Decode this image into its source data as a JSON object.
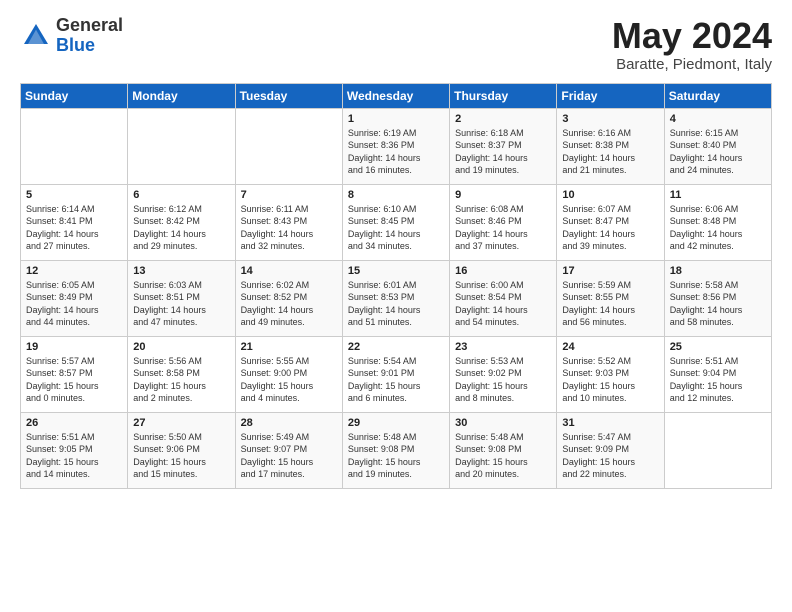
{
  "header": {
    "logo_general": "General",
    "logo_blue": "Blue",
    "month_title": "May 2024",
    "subtitle": "Baratte, Piedmont, Italy"
  },
  "days_of_week": [
    "Sunday",
    "Monday",
    "Tuesday",
    "Wednesday",
    "Thursday",
    "Friday",
    "Saturday"
  ],
  "weeks": [
    [
      {
        "day": "",
        "info": ""
      },
      {
        "day": "",
        "info": ""
      },
      {
        "day": "",
        "info": ""
      },
      {
        "day": "1",
        "info": "Sunrise: 6:19 AM\nSunset: 8:36 PM\nDaylight: 14 hours\nand 16 minutes."
      },
      {
        "day": "2",
        "info": "Sunrise: 6:18 AM\nSunset: 8:37 PM\nDaylight: 14 hours\nand 19 minutes."
      },
      {
        "day": "3",
        "info": "Sunrise: 6:16 AM\nSunset: 8:38 PM\nDaylight: 14 hours\nand 21 minutes."
      },
      {
        "day": "4",
        "info": "Sunrise: 6:15 AM\nSunset: 8:40 PM\nDaylight: 14 hours\nand 24 minutes."
      }
    ],
    [
      {
        "day": "5",
        "info": "Sunrise: 6:14 AM\nSunset: 8:41 PM\nDaylight: 14 hours\nand 27 minutes."
      },
      {
        "day": "6",
        "info": "Sunrise: 6:12 AM\nSunset: 8:42 PM\nDaylight: 14 hours\nand 29 minutes."
      },
      {
        "day": "7",
        "info": "Sunrise: 6:11 AM\nSunset: 8:43 PM\nDaylight: 14 hours\nand 32 minutes."
      },
      {
        "day": "8",
        "info": "Sunrise: 6:10 AM\nSunset: 8:45 PM\nDaylight: 14 hours\nand 34 minutes."
      },
      {
        "day": "9",
        "info": "Sunrise: 6:08 AM\nSunset: 8:46 PM\nDaylight: 14 hours\nand 37 minutes."
      },
      {
        "day": "10",
        "info": "Sunrise: 6:07 AM\nSunset: 8:47 PM\nDaylight: 14 hours\nand 39 minutes."
      },
      {
        "day": "11",
        "info": "Sunrise: 6:06 AM\nSunset: 8:48 PM\nDaylight: 14 hours\nand 42 minutes."
      }
    ],
    [
      {
        "day": "12",
        "info": "Sunrise: 6:05 AM\nSunset: 8:49 PM\nDaylight: 14 hours\nand 44 minutes."
      },
      {
        "day": "13",
        "info": "Sunrise: 6:03 AM\nSunset: 8:51 PM\nDaylight: 14 hours\nand 47 minutes."
      },
      {
        "day": "14",
        "info": "Sunrise: 6:02 AM\nSunset: 8:52 PM\nDaylight: 14 hours\nand 49 minutes."
      },
      {
        "day": "15",
        "info": "Sunrise: 6:01 AM\nSunset: 8:53 PM\nDaylight: 14 hours\nand 51 minutes."
      },
      {
        "day": "16",
        "info": "Sunrise: 6:00 AM\nSunset: 8:54 PM\nDaylight: 14 hours\nand 54 minutes."
      },
      {
        "day": "17",
        "info": "Sunrise: 5:59 AM\nSunset: 8:55 PM\nDaylight: 14 hours\nand 56 minutes."
      },
      {
        "day": "18",
        "info": "Sunrise: 5:58 AM\nSunset: 8:56 PM\nDaylight: 14 hours\nand 58 minutes."
      }
    ],
    [
      {
        "day": "19",
        "info": "Sunrise: 5:57 AM\nSunset: 8:57 PM\nDaylight: 15 hours\nand 0 minutes."
      },
      {
        "day": "20",
        "info": "Sunrise: 5:56 AM\nSunset: 8:58 PM\nDaylight: 15 hours\nand 2 minutes."
      },
      {
        "day": "21",
        "info": "Sunrise: 5:55 AM\nSunset: 9:00 PM\nDaylight: 15 hours\nand 4 minutes."
      },
      {
        "day": "22",
        "info": "Sunrise: 5:54 AM\nSunset: 9:01 PM\nDaylight: 15 hours\nand 6 minutes."
      },
      {
        "day": "23",
        "info": "Sunrise: 5:53 AM\nSunset: 9:02 PM\nDaylight: 15 hours\nand 8 minutes."
      },
      {
        "day": "24",
        "info": "Sunrise: 5:52 AM\nSunset: 9:03 PM\nDaylight: 15 hours\nand 10 minutes."
      },
      {
        "day": "25",
        "info": "Sunrise: 5:51 AM\nSunset: 9:04 PM\nDaylight: 15 hours\nand 12 minutes."
      }
    ],
    [
      {
        "day": "26",
        "info": "Sunrise: 5:51 AM\nSunset: 9:05 PM\nDaylight: 15 hours\nand 14 minutes."
      },
      {
        "day": "27",
        "info": "Sunrise: 5:50 AM\nSunset: 9:06 PM\nDaylight: 15 hours\nand 15 minutes."
      },
      {
        "day": "28",
        "info": "Sunrise: 5:49 AM\nSunset: 9:07 PM\nDaylight: 15 hours\nand 17 minutes."
      },
      {
        "day": "29",
        "info": "Sunrise: 5:48 AM\nSunset: 9:08 PM\nDaylight: 15 hours\nand 19 minutes."
      },
      {
        "day": "30",
        "info": "Sunrise: 5:48 AM\nSunset: 9:08 PM\nDaylight: 15 hours\nand 20 minutes."
      },
      {
        "day": "31",
        "info": "Sunrise: 5:47 AM\nSunset: 9:09 PM\nDaylight: 15 hours\nand 22 minutes."
      },
      {
        "day": "",
        "info": ""
      }
    ]
  ]
}
